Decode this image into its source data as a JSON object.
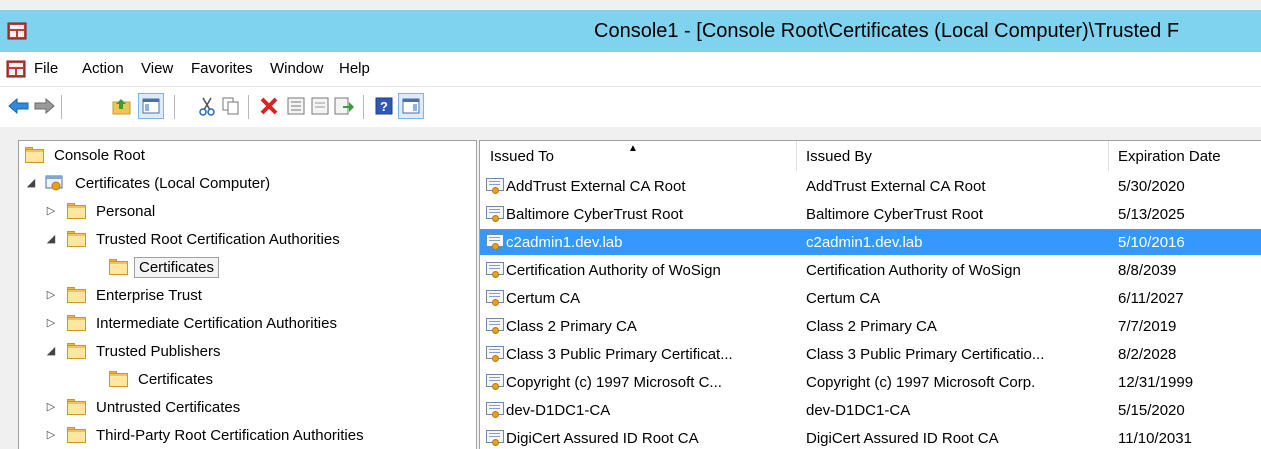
{
  "window": {
    "title": "Console1 - [Console Root\\Certificates (Local Computer)\\Trusted F"
  },
  "menu": {
    "items": [
      "File",
      "Action",
      "View",
      "Favorites",
      "Window",
      "Help"
    ]
  },
  "toolbar": {
    "icons": [
      "back-arrow-icon",
      "forward-arrow-icon",
      "up-folder-icon",
      "show-hide-console-tree-icon",
      "cut-icon",
      "copy-icon",
      "delete-icon",
      "properties-icon",
      "export-list-icon",
      "help-icon",
      "show-hide-action-pane-icon"
    ]
  },
  "tree": {
    "nodes": [
      {
        "label": "Console Root",
        "expander": "",
        "icon": "folder-icon"
      },
      {
        "label": "Certificates (Local Computer)",
        "expander": "◢",
        "icon": "certificates-store-icon"
      },
      {
        "label": "Personal",
        "expander": "▷",
        "icon": "folder-icon"
      },
      {
        "label": "Trusted Root Certification Authorities",
        "expander": "◢",
        "icon": "folder-icon"
      },
      {
        "label": "Certificates",
        "expander": "",
        "icon": "folder-icon",
        "selected": true
      },
      {
        "label": "Enterprise Trust",
        "expander": "▷",
        "icon": "folder-icon"
      },
      {
        "label": "Intermediate Certification Authorities",
        "expander": "▷",
        "icon": "folder-icon"
      },
      {
        "label": "Trusted Publishers",
        "expander": "◢",
        "icon": "folder-icon"
      },
      {
        "label": "Certificates",
        "expander": "",
        "icon": "folder-icon"
      },
      {
        "label": "Untrusted Certificates",
        "expander": "▷",
        "icon": "folder-icon"
      },
      {
        "label": "Third-Party Root Certification Authorities",
        "expander": "▷",
        "icon": "folder-icon"
      }
    ]
  },
  "list": {
    "columns": [
      "Issued To",
      "Issued By",
      "Expiration Date"
    ],
    "sort_indicator": "▲",
    "rows": [
      {
        "issued_to": "AddTrust External CA Root",
        "issued_by": "AddTrust External CA Root",
        "expiration": "5/30/2020"
      },
      {
        "issued_to": "Baltimore CyberTrust Root",
        "issued_by": "Baltimore CyberTrust Root",
        "expiration": "5/13/2025"
      },
      {
        "issued_to": "c2admin1.dev.lab",
        "issued_by": "c2admin1.dev.lab",
        "expiration": "5/10/2016",
        "selected": true
      },
      {
        "issued_to": "Certification Authority of WoSign",
        "issued_by": "Certification Authority of WoSign",
        "expiration": "8/8/2039"
      },
      {
        "issued_to": "Certum CA",
        "issued_by": "Certum CA",
        "expiration": "6/11/2027"
      },
      {
        "issued_to": "Class 2 Primary CA",
        "issued_by": "Class 2 Primary CA",
        "expiration": "7/7/2019"
      },
      {
        "issued_to": "Class 3 Public Primary Certificat...",
        "issued_by": "Class 3 Public Primary Certificatio...",
        "expiration": "8/2/2028"
      },
      {
        "issued_to": "Copyright (c) 1997 Microsoft C...",
        "issued_by": "Copyright (c) 1997 Microsoft Corp.",
        "expiration": "12/31/1999"
      },
      {
        "issued_to": "dev-D1DC1-CA",
        "issued_by": "dev-D1DC1-CA",
        "expiration": "5/15/2020"
      },
      {
        "issued_to": "DigiCert Assured ID Root CA",
        "issued_by": "DigiCert Assured ID Root CA",
        "expiration": "11/10/2031"
      }
    ]
  },
  "colors": {
    "title_bar": "#7fd3ee",
    "selection": "#3399ff"
  }
}
